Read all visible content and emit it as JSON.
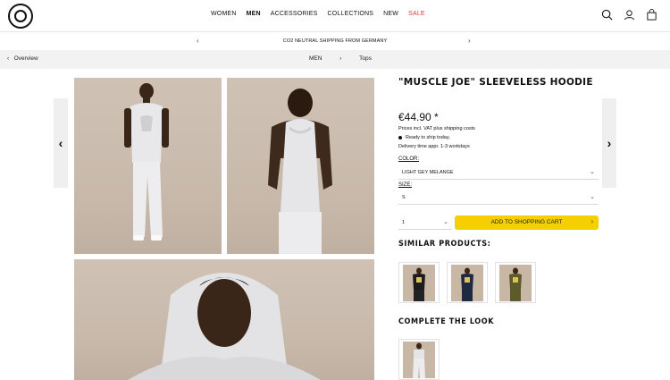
{
  "nav": {
    "items": [
      "WOMEN",
      "MEN",
      "ACCESSORIES",
      "COLLECTIONS",
      "NEW",
      "SALE"
    ]
  },
  "banner": {
    "text": "CO2 NEUTRAL SHIPPING FROM GERMANY",
    "prev": "‹",
    "next": "›"
  },
  "breadcrumb": {
    "back": "Overview",
    "items": [
      "MEN",
      "Tops"
    ],
    "sep": "›"
  },
  "product": {
    "title": "\"MUSCLE JOE\" SLEEVELESS HOODIE",
    "price": "€44.90 *",
    "price_note": "Prices incl. VAT plus shipping costs",
    "ready": "Ready to ship today,",
    "delivery": "Delivery time appr. 1-3 workdays",
    "color_label": "COLOR:",
    "color_value": "LIGHT GEY MELANGE",
    "size_label": "SIZE:",
    "size_value": "S",
    "qty_value": "1",
    "cart_label": "ADD TO SHOPPING CART"
  },
  "sections": {
    "similar": "SIMILAR PRODUCTS:",
    "complete": "COMPLETE THE LOOK"
  },
  "colors": {
    "accent": "#f5d000",
    "sale": "#d63b3b",
    "crumb_bg": "#f2f2f2"
  },
  "icons": [
    "logo",
    "search-icon",
    "user-icon",
    "bag-icon",
    "chevron-left-icon",
    "chevron-right-icon"
  ]
}
